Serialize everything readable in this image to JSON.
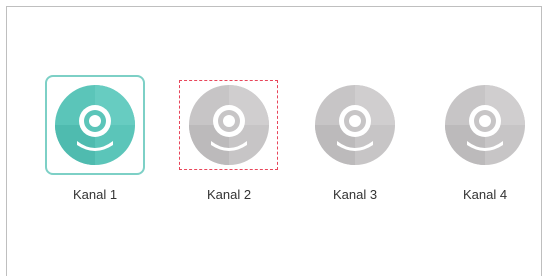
{
  "colors": {
    "active": "#5bc5b9",
    "active_dark": "#46b3a7",
    "inactive": "#c7c5c6",
    "inactive_dark": "#b7b5b6",
    "selected_border": "#7dd0c6",
    "focus_border": "#e8455a"
  },
  "channels": [
    {
      "label": "Kanal 1",
      "icon": "camera-icon",
      "state": "selected"
    },
    {
      "label": "Kanal 2",
      "icon": "camera-icon",
      "state": "focused"
    },
    {
      "label": "Kanal 3",
      "icon": "camera-icon",
      "state": "inactive"
    },
    {
      "label": "Kanal 4",
      "icon": "camera-icon",
      "state": "inactive"
    }
  ]
}
